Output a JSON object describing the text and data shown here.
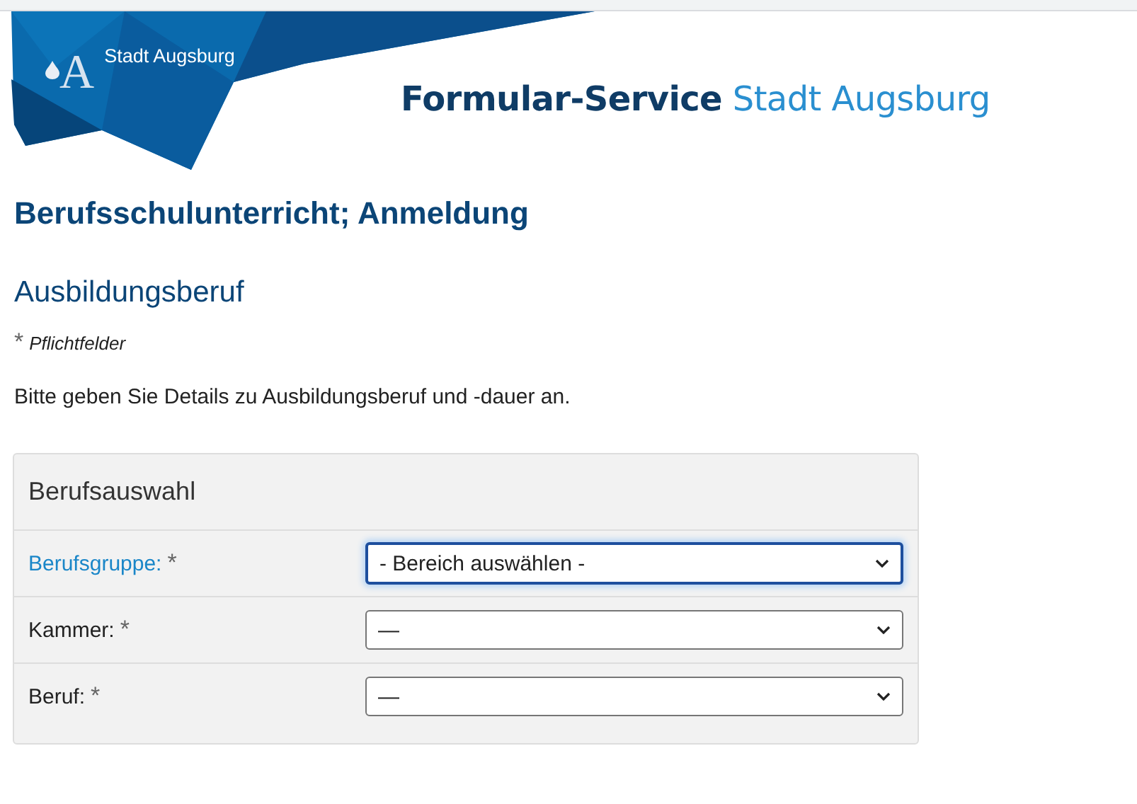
{
  "header": {
    "logo_letter": "A",
    "logo_text": "Stadt Augsburg",
    "title_bold": "Formular-Service",
    "title_light": "Stadt Augsburg"
  },
  "page_title": "Berufsschulunterricht; Anmeldung",
  "section_title": "Ausbildungsberuf",
  "required_note": {
    "mark": "*",
    "text": "Pflichtfelder"
  },
  "intro": "Bitte geben Sie Details zu Ausbildungsberuf und -dauer an.",
  "panel": {
    "title": "Berufsauswahl",
    "fields": [
      {
        "label": "Berufsgruppe:",
        "required_mark": "*",
        "value": "- Bereich auswählen -",
        "focused": true
      },
      {
        "label": "Kammer:",
        "required_mark": "*",
        "value": "—",
        "focused": false
      },
      {
        "label": "Beruf:",
        "required_mark": "*",
        "value": "—",
        "focused": false
      }
    ]
  }
}
